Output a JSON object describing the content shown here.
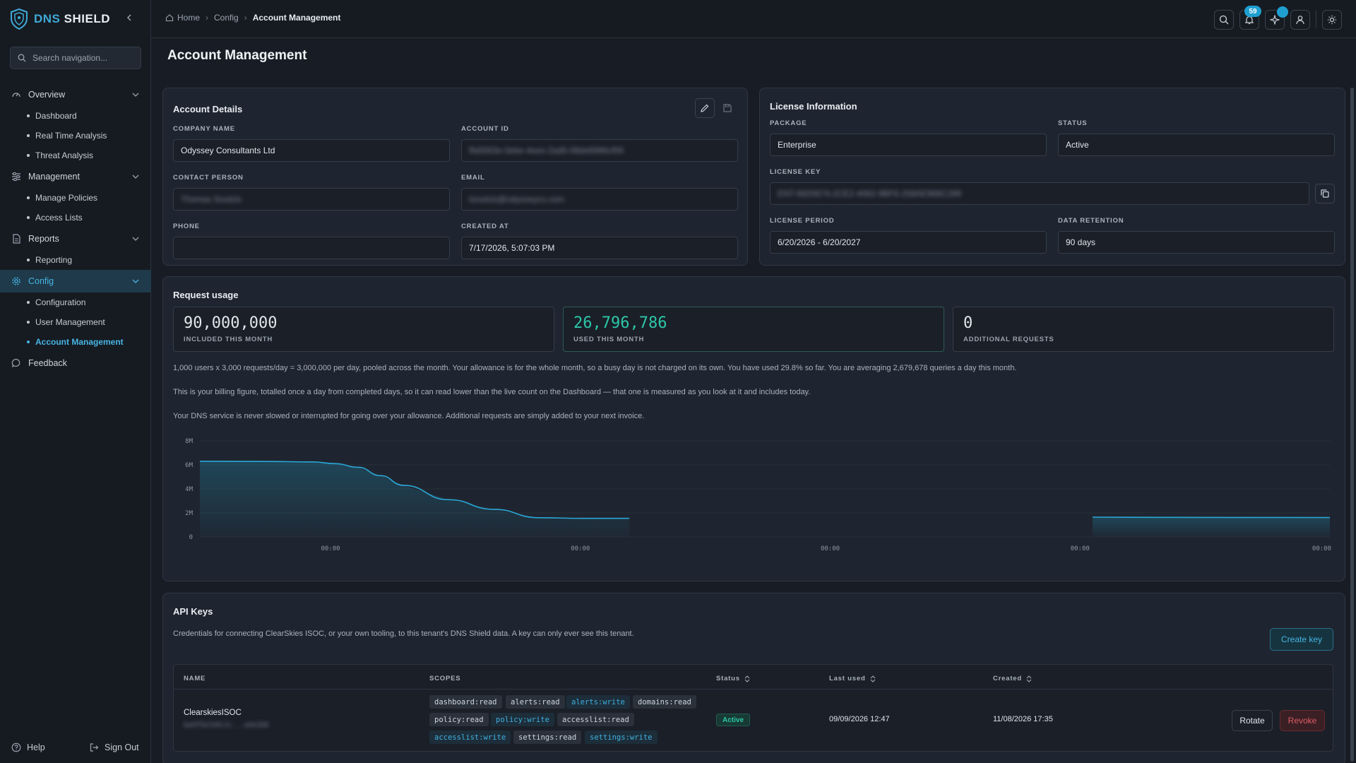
{
  "brand": {
    "part1": "DNS",
    "part2": "SHIELD"
  },
  "sidebar": {
    "search_placeholder": "Search navigation...",
    "groups": [
      {
        "label": "Overview",
        "items": [
          "Dashboard",
          "Real Time Analysis",
          "Threat Analysis"
        ]
      },
      {
        "label": "Management",
        "items": [
          "Manage Policies",
          "Access Lists"
        ]
      },
      {
        "label": "Reports",
        "items": [
          "Reporting"
        ]
      },
      {
        "label": "Config",
        "items": [
          "Configuration",
          "User Management",
          "Account Management"
        ]
      }
    ],
    "feedback": "Feedback",
    "help": "Help",
    "sign_out": "Sign Out"
  },
  "breadcrumb": [
    "Home",
    "Config",
    "Account Management"
  ],
  "topbar": {
    "notification_count": "59"
  },
  "page_title": "Account Management",
  "account": {
    "title": "Account Details",
    "company_name_label": "COMPANY NAME",
    "company_name": "Odyssey Consultants Ltd",
    "account_id_label": "ACCOUNT ID",
    "account_id": "ffa5563e-0ebe-4eee-2ad5-08de6986cf59",
    "contact_label": "CONTACT PERSON",
    "contact": "Thomas Soutzis",
    "email_label": "EMAIL",
    "email": "tsoutzis@odysseycs.com",
    "phone_label": "PHONE",
    "phone": "",
    "created_label": "CREATED AT",
    "created": "7/17/2026, 5:07:03 PM"
  },
  "license": {
    "title": "License Information",
    "package_label": "PACKAGE",
    "package": "Enterprise",
    "status_label": "STATUS",
    "status": "Active",
    "key_label": "LICENSE KEY",
    "key": "ENT-6920674-2CE2-4062-9BF6-258AE968C289",
    "period_label": "LICENSE PERIOD",
    "period": "6/20/2026 - 6/20/2027",
    "retention_label": "DATA RETENTION",
    "retention": "90 days"
  },
  "usage": {
    "title": "Request usage",
    "stats": [
      {
        "value": "90,000,000",
        "label": "INCLUDED THIS MONTH"
      },
      {
        "value": "26,796,786",
        "label": "USED THIS MONTH"
      },
      {
        "value": "0",
        "label": "ADDITIONAL REQUESTS"
      }
    ],
    "para1": "1,000 users x 3,000 requests/day = 3,000,000 per day, pooled across the month. Your allowance is for the whole month, so a busy day is not charged on its own. You have used 29.8% so far. You are averaging 2,679,678 queries a day this month.",
    "para2": "This is your billing figure, totalled once a day from completed days, so it can read lower than the live count on the Dashboard — that one is measured as you look at it and includes today.",
    "para3": "Your DNS service is never slowed or interrupted for going over your allowance. Additional requests are simply added to your next invoice."
  },
  "chart_data": {
    "type": "area",
    "y_ticks": [
      "8M",
      "6M",
      "4M",
      "2M",
      "0"
    ],
    "x_ticks": [
      "00:00",
      "00:00",
      "00:00",
      "00:00",
      "00:00"
    ],
    "ylim": [
      0,
      8000000
    ],
    "series": [
      {
        "segment": 1,
        "points": [
          [
            0,
            6300000
          ],
          [
            0.06,
            6280000
          ],
          [
            0.1,
            6250000
          ],
          [
            0.12,
            6100000
          ],
          [
            0.14,
            5800000
          ],
          [
            0.16,
            5100000
          ],
          [
            0.18,
            4300000
          ],
          [
            0.22,
            3100000
          ],
          [
            0.26,
            2300000
          ],
          [
            0.3,
            1600000
          ],
          [
            0.34,
            1550000
          ],
          [
            0.38,
            1550000
          ]
        ]
      },
      {
        "segment": 2,
        "points": [
          [
            0.79,
            1650000
          ],
          [
            0.85,
            1630000
          ],
          [
            1.0,
            1620000
          ]
        ]
      }
    ]
  },
  "api": {
    "title": "API Keys",
    "description": "Credentials for connecting ClearSkies ISOC, or your own tooling, to this tenant's DNS Shield data. A key can only ever see this tenant.",
    "create_label": "Create key",
    "columns": [
      "NAME",
      "SCOPES",
      "Status",
      "Last used",
      "Created"
    ],
    "rows": [
      {
        "name": "ClearskiesISOC",
        "key_hint": "ba4f5a7e0c1c...a4e2b8",
        "scopes": [
          {
            "label": "dashboard:read",
            "write": false
          },
          {
            "label": "alerts:read",
            "write": false
          },
          {
            "label": "alerts:write",
            "write": true
          },
          {
            "label": "domains:read",
            "write": false
          },
          {
            "label": "policy:read",
            "write": false
          },
          {
            "label": "policy:write",
            "write": true
          },
          {
            "label": "accesslist:read",
            "write": false
          },
          {
            "label": "accesslist:write",
            "write": true
          },
          {
            "label": "settings:read",
            "write": false
          },
          {
            "label": "settings:write",
            "write": true
          }
        ],
        "status": "Active",
        "last_used": "09/09/2026 12:47",
        "created": "11/08/2026 17:35",
        "rotate": "Rotate",
        "revoke": "Revoke"
      }
    ]
  }
}
